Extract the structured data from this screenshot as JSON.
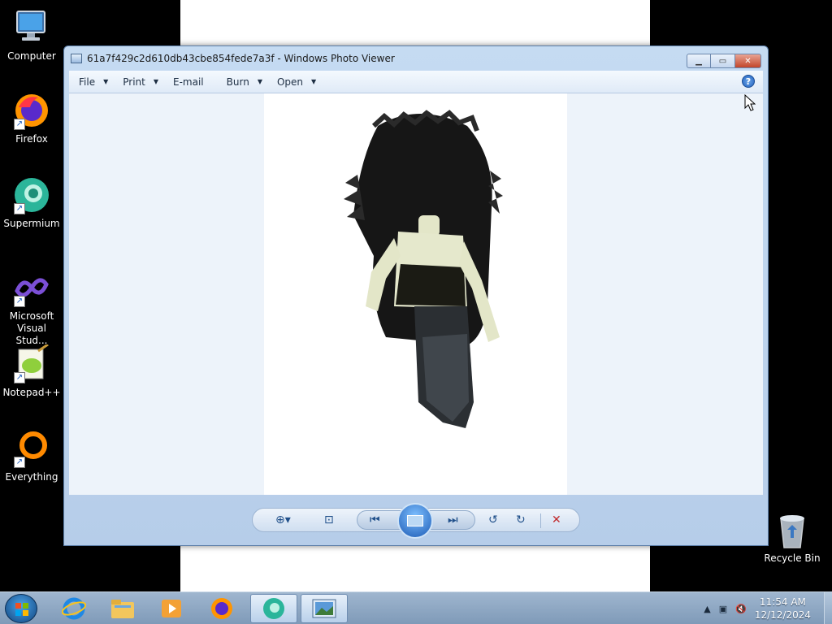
{
  "desktop": {
    "icons": [
      {
        "label": "Computer"
      },
      {
        "label": "Firefox"
      },
      {
        "label": "Supermium"
      },
      {
        "label": "Microsoft Visual Stud..."
      },
      {
        "label": "Notepad++"
      },
      {
        "label": "Everything"
      }
    ],
    "recycle_bin": "Recycle Bin"
  },
  "window": {
    "title": "61a7f429c2d610db43cbe854fede7a3f - Windows Photo Viewer",
    "menu": {
      "file": "File",
      "print": "Print",
      "email": "E-mail",
      "burn": "Burn",
      "open": "Open"
    },
    "help": "?"
  },
  "taskbar": {
    "clock": {
      "time": "11:54 AM",
      "date": "12/12/2024"
    }
  },
  "colors": {
    "accent": "#1f5fbf",
    "close": "#c2452a",
    "taskbar": "#8ea8c4"
  }
}
